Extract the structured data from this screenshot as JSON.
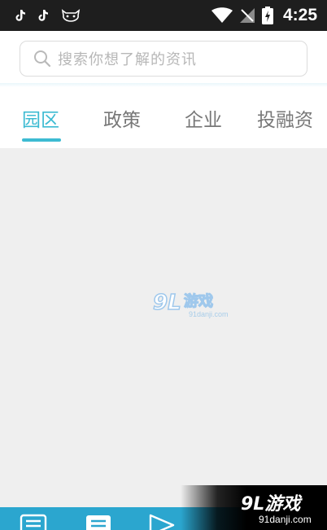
{
  "status_bar": {
    "time": "4:25",
    "left_icons": [
      "tiktok-icon",
      "tiktok-icon",
      "cat-face-icon"
    ],
    "right_icons": [
      "wifi-icon",
      "no-signal-icon",
      "battery-charging-icon"
    ]
  },
  "search": {
    "placeholder": "搜索你想了解的资讯"
  },
  "tabs": [
    {
      "label": "园区",
      "active": true
    },
    {
      "label": "政策",
      "active": false
    },
    {
      "label": "企业",
      "active": false
    },
    {
      "label": "投融资",
      "active": false
    }
  ],
  "watermark": {
    "logo": "9L游戏",
    "url": "91danji.com"
  },
  "bottom_nav": {
    "icons": [
      "list-icon",
      "document-icon",
      "send-icon"
    ]
  },
  "colors": {
    "accent": "#3dbbd2",
    "nav_bar": "#2ba6cf",
    "status_bar": "#1e1e1e",
    "content_bg": "#efefef"
  }
}
